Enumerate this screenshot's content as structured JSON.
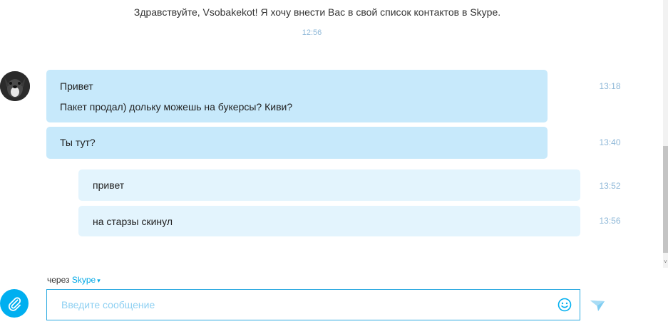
{
  "conversation": {
    "system_message": "Здравствуйте, Vsobakekot! Я хочу внести Вас в свой список контактов в Skype.",
    "system_time": "12:56",
    "messages": [
      {
        "direction": "incoming",
        "lines": [
          "Привет",
          "Пакет продал) дольку можешь на букерсы? Киви?"
        ],
        "time": "13:18"
      },
      {
        "direction": "incoming",
        "lines": [
          "Ты тут?"
        ],
        "time": "13:40"
      },
      {
        "direction": "outgoing",
        "lines": [
          "привет"
        ],
        "time": "13:52"
      },
      {
        "direction": "outgoing",
        "lines": [
          "на старзы скинул"
        ],
        "time": "13:56"
      }
    ]
  },
  "composer": {
    "via_label": "через",
    "via_service": "Skype",
    "via_caret": "▾",
    "placeholder": "Введите сообщение",
    "value": ""
  },
  "icons": {
    "attach": "paperclip-icon",
    "emoji": "smiley-icon",
    "send": "send-arrow-icon",
    "avatar": "dog-avatar"
  },
  "colors": {
    "accent": "#00aff0",
    "incoming_bubble": "#c7e9fb",
    "outgoing_bubble": "#e3f4fd",
    "timestamp": "#8fb8d8"
  }
}
